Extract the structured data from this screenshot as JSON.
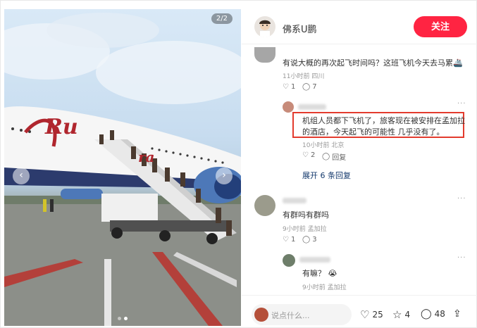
{
  "photo": {
    "counter": "2/2",
    "airline_mark": "Ru",
    "airline_mark_tail": "ra"
  },
  "header": {
    "author": "佛系U鹏",
    "follow_label": "关注"
  },
  "comments": [
    {
      "text": "有说大概的再次起飞时间吗？这班飞机今天去马累",
      "emoji": "🚢",
      "meta": "11小时前 四川",
      "likes": "1",
      "replies": "7"
    },
    {
      "text_line1": "机组人员都下飞机了，旅客现在被安排在孟加拉",
      "text_line2": "的酒店，今天起飞的可能性 几乎没有了。",
      "meta": "10小时前 北京",
      "likes": "2",
      "reply_label": "回复"
    },
    {
      "expand_label": "展开 6 条回复"
    },
    {
      "text": "有群吗有群吗",
      "meta": "9小时前 孟加拉",
      "likes": "1",
      "replies": "3"
    },
    {
      "text": "有嘛？",
      "emoji": "😭",
      "meta": "9小时前 孟加拉"
    }
  ],
  "footer": {
    "placeholder": "说点什么...",
    "likes": "25",
    "stars": "4",
    "comments": "48"
  },
  "colors": {
    "accent": "#ff2442",
    "highlight_box": "#e33b2e",
    "link": "#13386c"
  }
}
